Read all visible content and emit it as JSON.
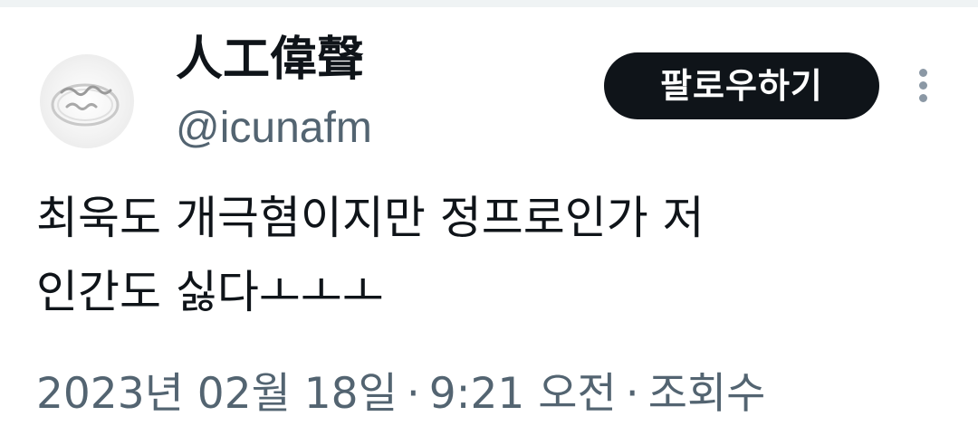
{
  "tweet": {
    "author": {
      "display_name": "人工偉聲",
      "handle": "@icunafm",
      "avatar_icon": "ring-photo-icon"
    },
    "follow_label": "팔로우하기",
    "more_icon": "more-vertical-icon",
    "text_lines": [
      "최욱도 개극혐이지만 정프로인가 저",
      "인간도 싫다ㅗㅗㅗ"
    ],
    "meta": {
      "date": "2023년 02월 18일",
      "separator": "·",
      "time": "9:21 오전",
      "views_label": "조회수"
    }
  },
  "colors": {
    "text_primary": "#0f1419",
    "text_secondary": "#536471",
    "button_bg": "#0f1419",
    "button_text": "#ffffff",
    "divider": "#eff3f4"
  }
}
